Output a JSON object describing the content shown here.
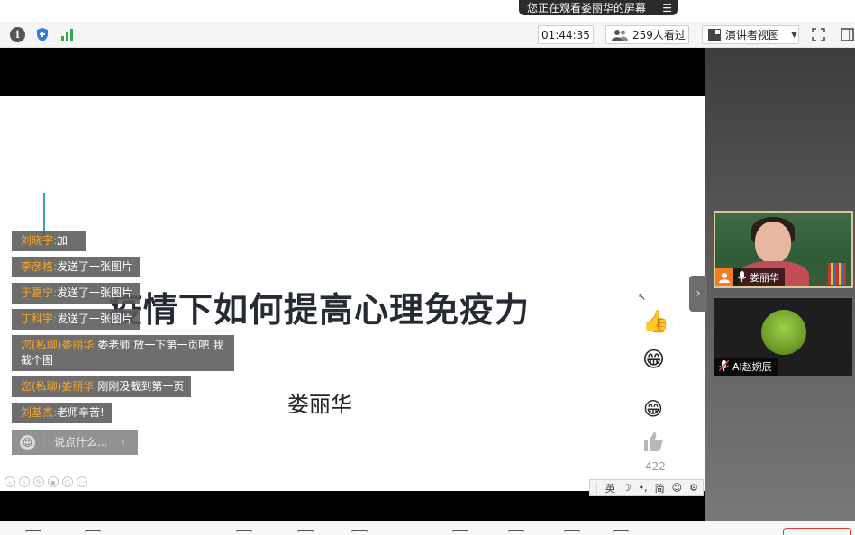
{
  "banner": {
    "text": "您正在观看娄丽华的屏幕",
    "menu_icon": "menu-icon"
  },
  "toolbar": {
    "timer": "01:44:35",
    "viewers": "259人看过",
    "view_mode": "演讲者视图",
    "icons": [
      "info-icon",
      "shield-icon",
      "signal-icon",
      "fullscreen-icon",
      "layout-icon"
    ]
  },
  "slide": {
    "title": "疫情下如何提高心理免疫力",
    "author": "娄丽华"
  },
  "chat": {
    "messages": [
      {
        "name": "刘晓宇:",
        "text": "加一"
      },
      {
        "name": "李彦格:",
        "text": "发送了一张图片"
      },
      {
        "name": "于嘉宁:",
        "text": "发送了一张图片"
      },
      {
        "name": "丁科宇:",
        "text": "发送了一张图片"
      },
      {
        "name": "您(私聊)娄丽华:",
        "text": "娄老师 放一下第一页吧 我截个图"
      },
      {
        "name": "您(私聊)娄丽华:",
        "text": "刚刚没截到第一页"
      },
      {
        "name": "刘基杰:",
        "text": "老师辛苦!"
      }
    ],
    "input_placeholder": "说点什么..."
  },
  "reactions": {
    "like_count": "422"
  },
  "ime": {
    "mode": "英",
    "simplified": "简"
  },
  "participants": [
    {
      "name": "娄丽华"
    },
    {
      "name": "AI赵婉辰"
    }
  ]
}
